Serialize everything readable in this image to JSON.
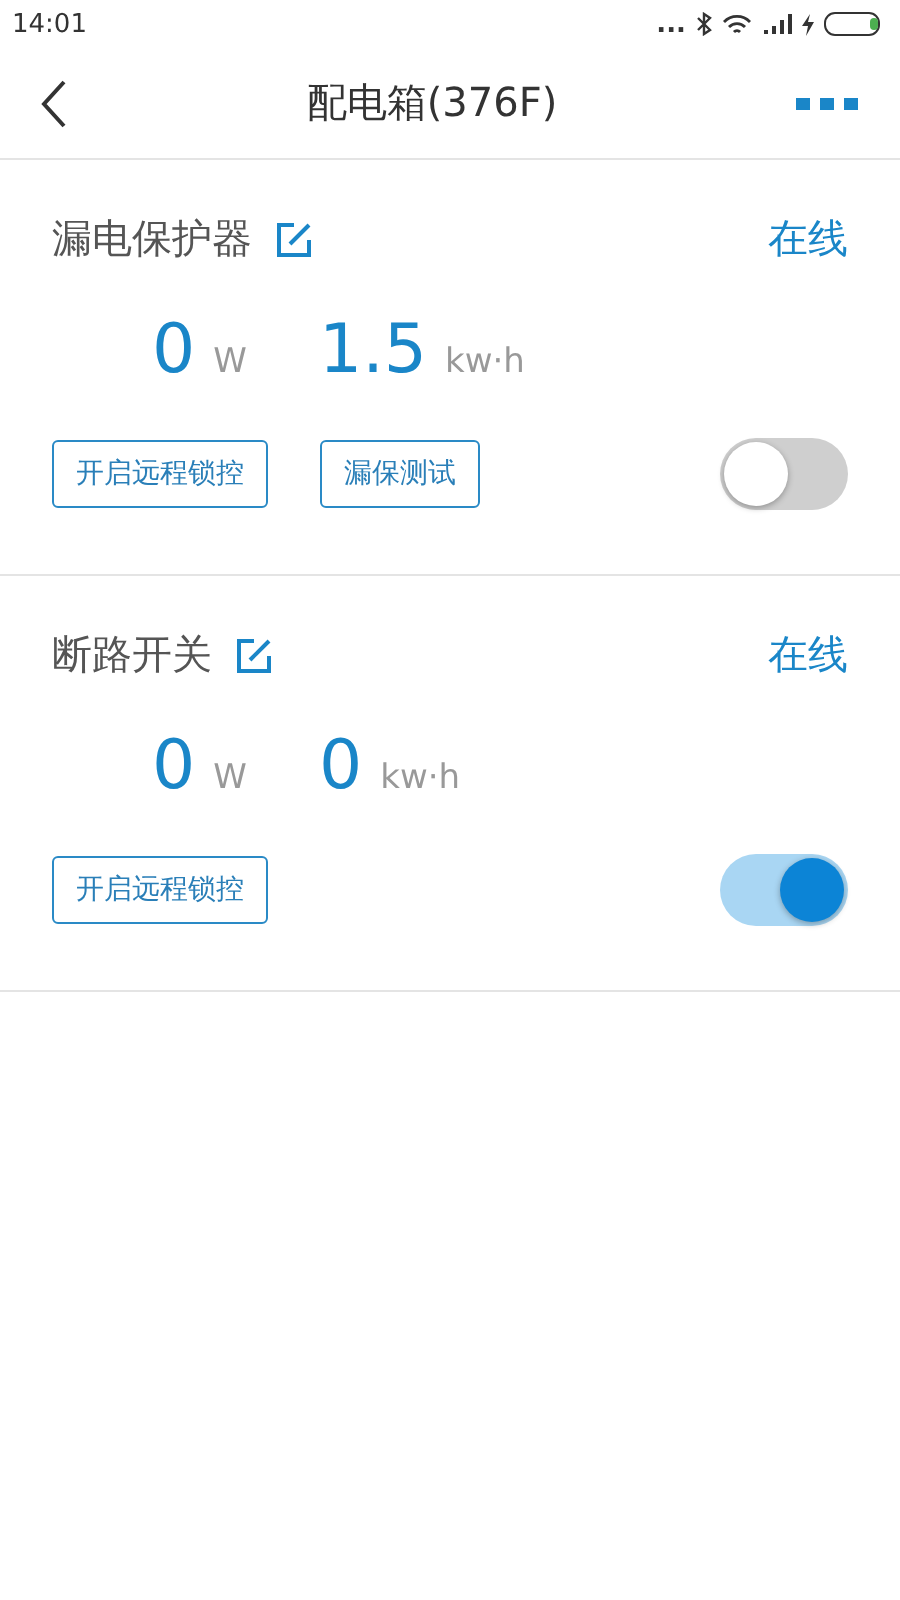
{
  "status_bar": {
    "time": "14:01",
    "dots": "..."
  },
  "header": {
    "title": "配电箱(376F)"
  },
  "devices": [
    {
      "name": "漏电保护器",
      "status": "在线",
      "metrics": [
        {
          "value": "0",
          "unit": "W"
        },
        {
          "value": "1.5",
          "unit": "kw·h"
        }
      ],
      "buttons": [
        "开启远程锁控",
        "漏保测试"
      ],
      "on": false
    },
    {
      "name": "断路开关",
      "status": "在线",
      "metrics": [
        {
          "value": "0",
          "unit": "W"
        },
        {
          "value": "0",
          "unit": "kw·h"
        }
      ],
      "buttons": [
        "开启远程锁控"
      ],
      "on": true
    }
  ]
}
